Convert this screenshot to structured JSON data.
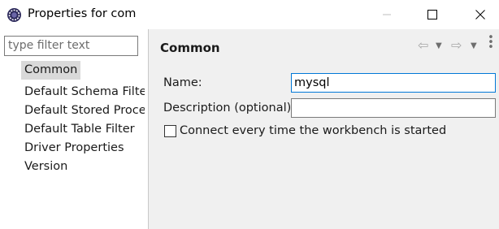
{
  "window": {
    "title": "Properties for com",
    "minimize_icon": "minimize-icon",
    "maximize_icon": "maximize-icon",
    "close_icon": "close-icon"
  },
  "filter": {
    "placeholder": "type filter text",
    "value": ""
  },
  "tree": {
    "items": [
      {
        "label": "Common",
        "selected": true
      },
      {
        "label": "Default Schema Filte"
      },
      {
        "label": "Default Stored Proce"
      },
      {
        "label": "Default Table Filter"
      },
      {
        "label": "Driver Properties"
      },
      {
        "label": "Version"
      }
    ]
  },
  "page": {
    "title": "Common",
    "name_label": "Name:",
    "name_value": "mysql",
    "description_label": "Description (optional):",
    "description_value": "",
    "checkbox_label": "Connect every time the workbench is started",
    "checkbox_checked": false
  },
  "colors": {
    "accent": "#0078d7",
    "panel_bg": "#f0f0f0",
    "selection": "#d9d9d9"
  }
}
